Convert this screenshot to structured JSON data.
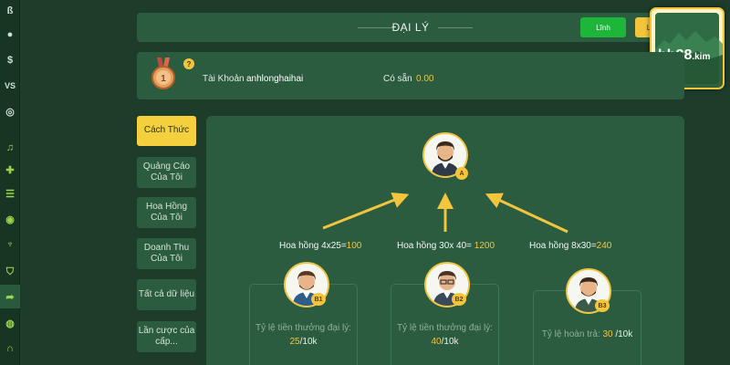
{
  "rail_icons": [
    "hb-logo-icon",
    "soccer-ball-icon",
    "wallet-icon",
    "vs-icon",
    "chip-icon",
    "music-icon",
    "gift-icon",
    "list-icon",
    "badge-icon",
    "trophy-icon",
    "shield-icon",
    "share-icon",
    "coin-icon",
    "headset-icon"
  ],
  "header": {
    "title": "ĐẠI LÝ",
    "claim_label": "Lĩnh",
    "claim2_label": "L"
  },
  "logo": {
    "text": "hb88",
    "suffix": ".kim"
  },
  "account": {
    "rank": "1",
    "help": "?",
    "account_label": "Tài Khoản",
    "username": "anhlonghaihai",
    "available_label": "Có sẵn",
    "available_value": "0.00"
  },
  "menu": [
    {
      "label": "Cách Thức"
    },
    {
      "label": "Quảng Cáo Của Tôi"
    },
    {
      "label": "Hoa Hồng Của Tôi"
    },
    {
      "label": "Doanh Thu Của Tôi"
    },
    {
      "label": "Tất cả dữ liệu"
    },
    {
      "label": "Lần cược của cấp..."
    }
  ],
  "diagram": {
    "top_badge": "A",
    "agents": [
      {
        "badge": "B1",
        "commission_label": "Hoa hồng 4x25=",
        "commission_value": "100",
        "rate_label": "Tỷ lệ tiền thưởng đại lý:",
        "rate_value": "25",
        "rate_unit": "/10k"
      },
      {
        "badge": "B2",
        "commission_label": "Hoa hồng 30x 40= ",
        "commission_value": "1200",
        "rate_label": "Tỷ lệ tiền thưởng đại lý:",
        "rate_value": "40",
        "rate_unit": "/10k"
      },
      {
        "badge": "B3",
        "commission_label": "Hoa hồng 8x30=",
        "commission_value": "240",
        "rate_label": "Tỷ lệ hoàn trả:",
        "rate_value": "30",
        "rate_unit": " /10k"
      }
    ]
  },
  "colors": {
    "background": "#1d3d2a",
    "panel": "#2b5c40",
    "accent_yellow": "#f2c53d",
    "claim_green": "#1db53a"
  }
}
